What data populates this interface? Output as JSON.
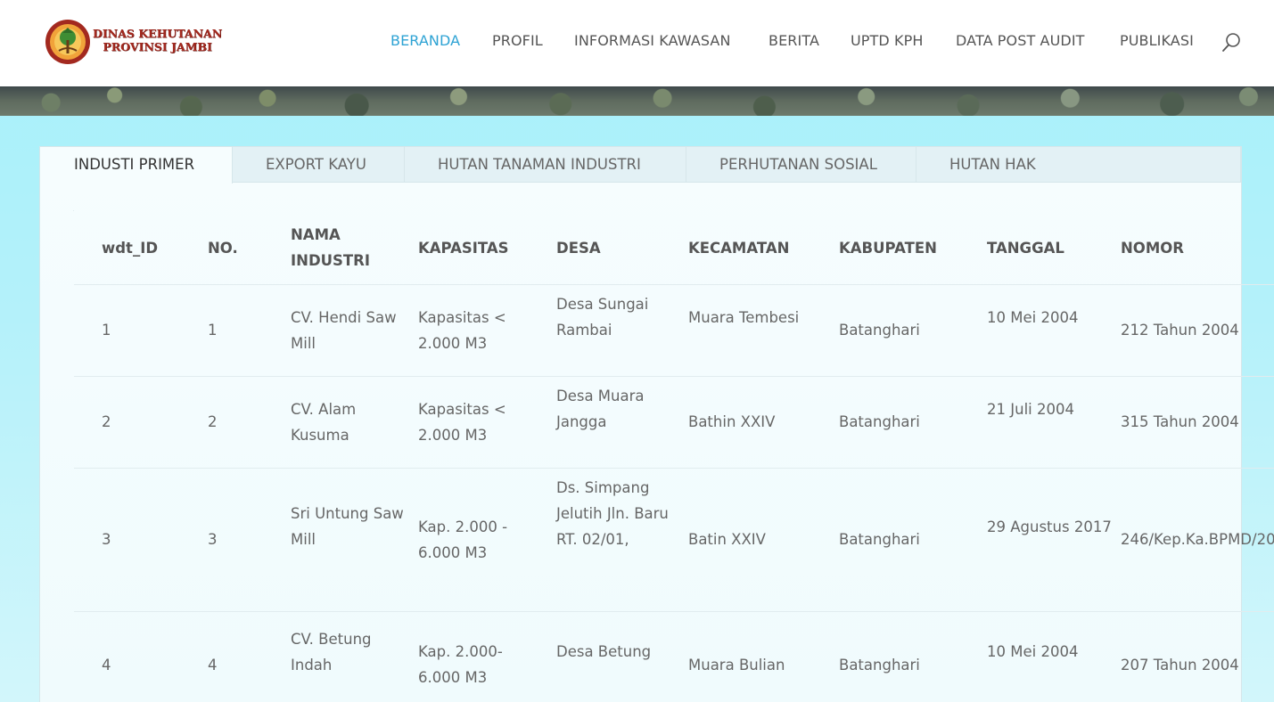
{
  "header": {
    "logo": {
      "line1": "DINAS KEHUTANAN",
      "line2": "PROVINSI JAMBI"
    },
    "nav": [
      "BERANDA",
      "PROFIL",
      "INFORMASI KAWASAN",
      "BERITA",
      "UPTD KPH",
      "DATA POST AUDIT",
      "PUBLIKASI"
    ],
    "active_nav": "BERANDA"
  },
  "tabs": [
    "INDUSTI PRIMER",
    "EXPORT KAYU",
    "HUTAN TANAMAN INDUSTRI",
    "PERHUTANAN SOSIAL",
    "HUTAN HAK"
  ],
  "active_tab": "INDUSTI PRIMER",
  "table": {
    "headers": [
      "wdt_ID",
      "NO.",
      "NAMA INDUSTRI",
      "KAPASITAS",
      "DESA",
      "KECAMATAN",
      "KABUPATEN",
      "TANGGAL",
      "NOMOR"
    ],
    "rows": [
      [
        "1",
        "1",
        "CV. Hendi Saw Mill",
        "Kapasitas < 2.000 M3",
        "Desa Sungai Rambai",
        "Muara Tembesi",
        "Batanghari",
        "10 Mei 2004",
        "212 Tahun 2004"
      ],
      [
        "2",
        "2",
        "CV. Alam Kusuma",
        "Kapasitas < 2.000 M3",
        "Desa Muara Jangga",
        "Bathin XXIV",
        "Batanghari",
        "21 Juli 2004",
        "315 Tahun 2004"
      ],
      [
        "3",
        "3",
        "Sri Untung Saw Mill",
        "Kap. 2.000 - 6.000 M3",
        "Ds. Simpang Jelutih Jln. Baru RT. 02/01,",
        "Batin XXIV",
        "Batanghari",
        "29 Agustus 2017",
        "246/Kep.Ka.BPMD/20"
      ],
      [
        "4",
        "4",
        "CV. Betung Indah",
        "Kap. 2.000- 6.000 M3",
        "Desa Betung",
        "Muara Bulian",
        "Batanghari",
        "10 Mei 2004",
        "207 Tahun 2004"
      ]
    ]
  },
  "colors": {
    "accent": "#2ea3d4",
    "logo_red": "#a3291f",
    "background": "#a6f1fb"
  }
}
